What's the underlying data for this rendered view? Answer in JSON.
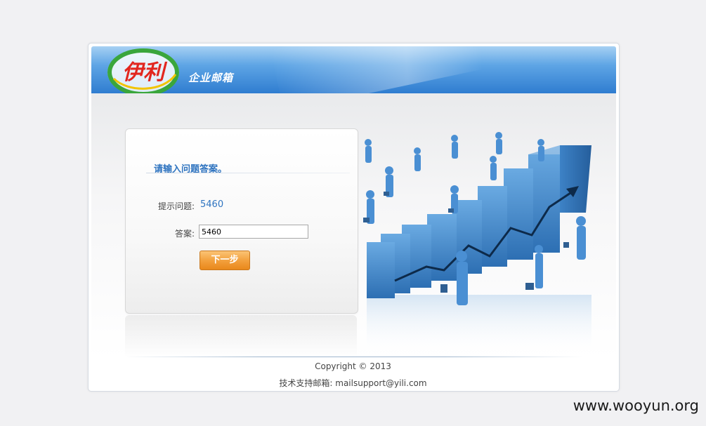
{
  "header": {
    "logo_text": "伊利",
    "system_title": "企业邮箱"
  },
  "form": {
    "title": "请输入问题答案。",
    "question_label": "提示问题:",
    "question_value": "5460",
    "answer_label": "答案:",
    "answer_value": "5460",
    "next_button": "下一步"
  },
  "footer": {
    "copyright": "Copyright © 2013",
    "support": "技术支持邮箱: mailsupport@yili.com"
  },
  "watermark": "www.wooyun.org",
  "colors": {
    "header_blue": "#2f7dd0",
    "title_blue": "#2f74c0",
    "button_orange": "#f3a13e",
    "logo_red": "#e2261f",
    "logo_green": "#3aa63c"
  }
}
